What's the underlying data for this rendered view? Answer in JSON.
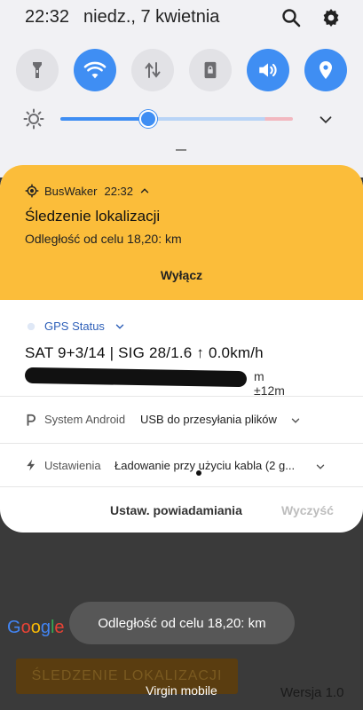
{
  "status_bar": {
    "time": "22:32",
    "date": "niedz., 7 kwietnia",
    "icons": [
      "search-icon",
      "gear-icon"
    ]
  },
  "quick_settings": {
    "tiles": [
      {
        "name": "flashlight",
        "icon": "flashlight-icon",
        "active": false
      },
      {
        "name": "wifi",
        "icon": "wifi-icon",
        "active": true
      },
      {
        "name": "mobile-data",
        "icon": "data-arrows-icon",
        "active": false
      },
      {
        "name": "screen-lock",
        "icon": "lock-screen-icon",
        "active": false
      },
      {
        "name": "sound",
        "icon": "volume-icon",
        "active": true
      },
      {
        "name": "location",
        "icon": "location-pin-icon",
        "active": true
      }
    ],
    "brightness": 0.37,
    "accent": "#3f8ef3"
  },
  "notifications": {
    "buswaker": {
      "app": "BusWaker",
      "time": "22:32",
      "title": "Śledzenie lokalizacji",
      "text": "Odległość od celu 18,20: km",
      "action": "Wyłącz",
      "color": "#fbbd3a"
    },
    "gps": {
      "app": "GPS Status",
      "line1": "SAT 9+3/14 | SIG 28/1.6 ↑ 0.0km/h",
      "accuracy": "m ±12m"
    },
    "system": {
      "app": "System Android",
      "text": "USB do przesyłania plików"
    },
    "settings": {
      "app": "Ustawienia",
      "text": "Ładowanie przy użyciu kabla (2 g..."
    },
    "footer": {
      "settings_button": "Ustaw. powiadamiania",
      "clear_button": "Wyczyść"
    }
  },
  "background_app": {
    "google_logo": "Google",
    "toast": "Odległość od celu 18,20: km",
    "button": "ŚLEDZENIE LOKALIZACJI",
    "carrier": "Virgin mobile",
    "version": "Wersja 1.0"
  }
}
